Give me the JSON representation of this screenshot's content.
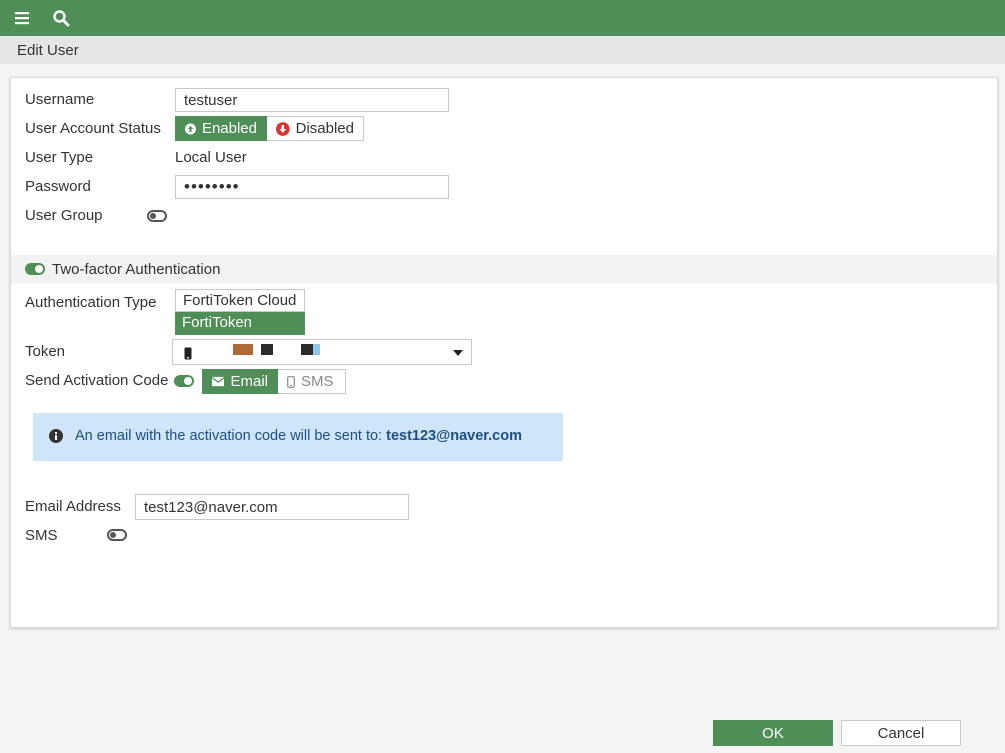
{
  "topbar": {
    "menu_icon": "menu-icon",
    "search_icon": "search-icon"
  },
  "header": {
    "title": "Edit User"
  },
  "form": {
    "username": {
      "label": "Username",
      "value": "testuser"
    },
    "status": {
      "label": "User Account Status",
      "enabled_label": "Enabled",
      "disabled_label": "Disabled",
      "selected": "Enabled"
    },
    "user_type": {
      "label": "User Type",
      "value": "Local User"
    },
    "password": {
      "label": "Password",
      "value": "••••••••"
    },
    "user_group": {
      "label": "User Group",
      "enabled": false
    }
  },
  "two_factor": {
    "label": "Two-factor Authentication",
    "enabled": true,
    "auth_type": {
      "label": "Authentication Type",
      "options": [
        "FortiToken Cloud",
        "FortiToken"
      ],
      "selected": "FortiToken"
    },
    "token": {
      "label": "Token"
    },
    "send_activation": {
      "label": "Send Activation Code",
      "enabled": true,
      "email_label": "Email",
      "sms_label": "SMS",
      "selected": "Email"
    },
    "info": {
      "text": "An email with the activation code will be sent to:",
      "email": "test123@naver.com"
    }
  },
  "contact": {
    "email": {
      "label": "Email Address",
      "value": "test123@naver.com"
    },
    "sms": {
      "label": "SMS",
      "enabled": false
    }
  },
  "buttons": {
    "ok": "OK",
    "cancel": "Cancel"
  },
  "colors": {
    "accent": "#4f8f57",
    "info_bg": "#cfe5fa",
    "info_text": "#1f4f82",
    "danger": "#d9332b"
  }
}
